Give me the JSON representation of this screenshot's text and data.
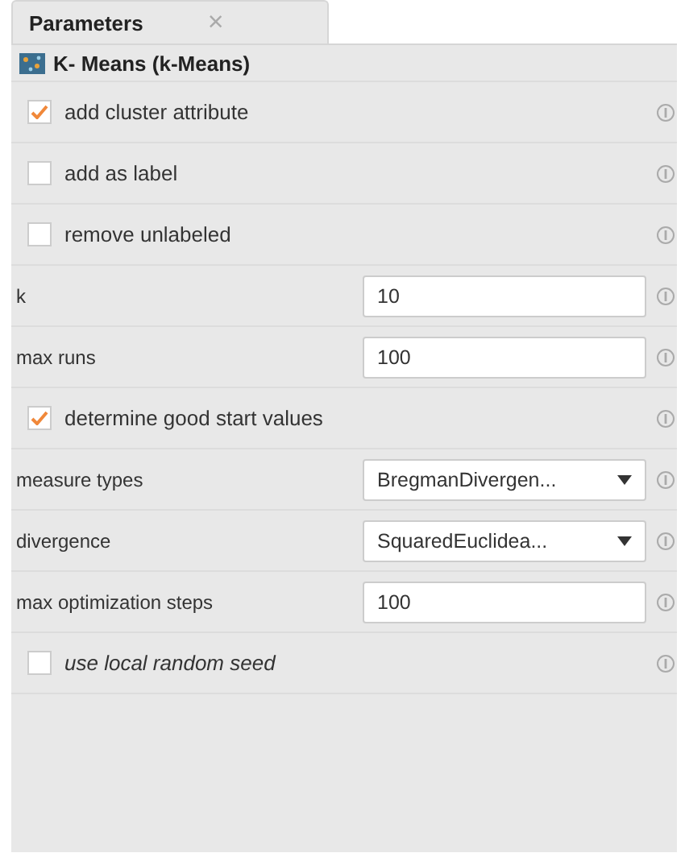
{
  "tab": {
    "label": "Parameters",
    "close": "×"
  },
  "operator": {
    "title": "K- Means (k-Means)"
  },
  "parameters": [
    {
      "kind": "checkbox",
      "label": "add cluster attribute",
      "checked": true,
      "italic": false
    },
    {
      "kind": "checkbox",
      "label": "add as label",
      "checked": false,
      "italic": false
    },
    {
      "kind": "checkbox",
      "label": "remove unlabeled",
      "checked": false,
      "italic": false
    },
    {
      "kind": "text",
      "label": "k",
      "value": "10"
    },
    {
      "kind": "text",
      "label": "max runs",
      "value": "100"
    },
    {
      "kind": "checkbox",
      "label": "determine good start values",
      "checked": true,
      "italic": false
    },
    {
      "kind": "dropdown",
      "label": "measure types",
      "value": "BregmanDivergen..."
    },
    {
      "kind": "dropdown",
      "label": "divergence",
      "value": "SquaredEuclidea..."
    },
    {
      "kind": "text",
      "label": "max optimization steps",
      "value": "100"
    },
    {
      "kind": "checkbox",
      "label": "use local random seed",
      "checked": false,
      "italic": true
    }
  ]
}
